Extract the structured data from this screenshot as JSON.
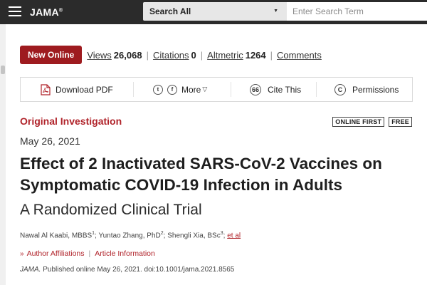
{
  "topbar": {
    "logo": "JAMA",
    "logo_mark": "®",
    "search_scope": "Search All",
    "search_placeholder": "Enter Search Term"
  },
  "meta": {
    "badge": "New Online",
    "views_label": "Views",
    "views_value": "26,068",
    "citations_label": "Citations",
    "citations_value": "0",
    "altmetric_label": "Altmetric",
    "altmetric_value": "1264",
    "comments_label": "Comments"
  },
  "toolbar": {
    "download_pdf": "Download PDF",
    "more": "More",
    "cite_this": "Cite This",
    "permissions": "Permissions",
    "twitter_glyph": "t",
    "facebook_glyph": "f",
    "cite_glyph": "66",
    "copyright_glyph": "C"
  },
  "article": {
    "section": "Original Investigation",
    "tags": [
      "ONLINE FIRST",
      "FREE"
    ],
    "date": "May 26, 2021",
    "title": "Effect of 2 Inactivated SARS-CoV-2 Vaccines on Symptomatic COVID-19 Infection in Adults",
    "subtitle": "A Randomized Clinical Trial",
    "authors": [
      {
        "name": "Nawal Al Kaabi, MBBS",
        "sup": "1"
      },
      {
        "name": "Yuntao Zhang, PhD",
        "sup": "2"
      },
      {
        "name": "Shengli Xia, BSc",
        "sup": "3"
      }
    ],
    "et_al": "et al",
    "author_affiliations": "Author Affiliations",
    "article_information": "Article Information",
    "journal": "JAMA.",
    "citation": "Published online May 26, 2021. doi:10.1001/jama.2021.8565"
  },
  "colors": {
    "topbar_bg": "#2b2b2b",
    "brand_red": "#9e1b1f",
    "section_red": "#b0232a"
  }
}
